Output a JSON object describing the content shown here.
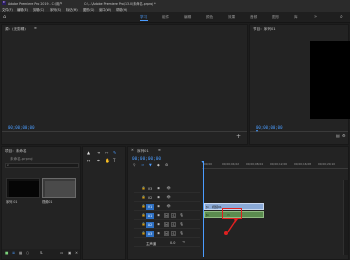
{
  "titlebar": {
    "app": "Adobe Premiere Pro 2019 - C:\\用户",
    "document": "C:\\...\\Adobe Premiere Pro\\13.0\\未命名.prproj *"
  },
  "menubar": [
    "文件(F)",
    "编辑(E)",
    "剪辑(C)",
    "序列(S)",
    "标记(M)",
    "图形(G)",
    "窗口(W)",
    "帮助(H)"
  ],
  "workspaces": [
    "学习",
    "组件",
    "编辑",
    "颜色",
    "效果",
    "音频",
    "图形",
    "库"
  ],
  "source": {
    "title": "源：(无剪辑)",
    "timecode": "00;00;00;00"
  },
  "program": {
    "title": "节目：序列01",
    "timecode": "00;00;00;00"
  },
  "project": {
    "title": "项目：未命名",
    "file": "未命名.prproj",
    "items": [
      {
        "name": "序列 01",
        "duration": ""
      },
      {
        "name": "视频01",
        "duration": ""
      }
    ]
  },
  "timeline": {
    "tab": "序列01",
    "timecode": "00;00;00;00",
    "ruler": [
      "00;00",
      "00;00;04;02",
      "00;00;08;04",
      "00;00;12;06",
      "00;00;16;08",
      "00;00;20;10"
    ],
    "video_tracks": [
      "V3",
      "V2",
      "V1"
    ],
    "audio_tracks": [
      "A1",
      "A2",
      "A3"
    ],
    "master_label": "主声道",
    "master_value": "0.0",
    "clip_label": "视频01"
  },
  "colors": {
    "accent": "#4a9cff",
    "callout": "#e02020",
    "clip_video": "#8aa9d6",
    "clip_audio": "#5b8c4f"
  }
}
